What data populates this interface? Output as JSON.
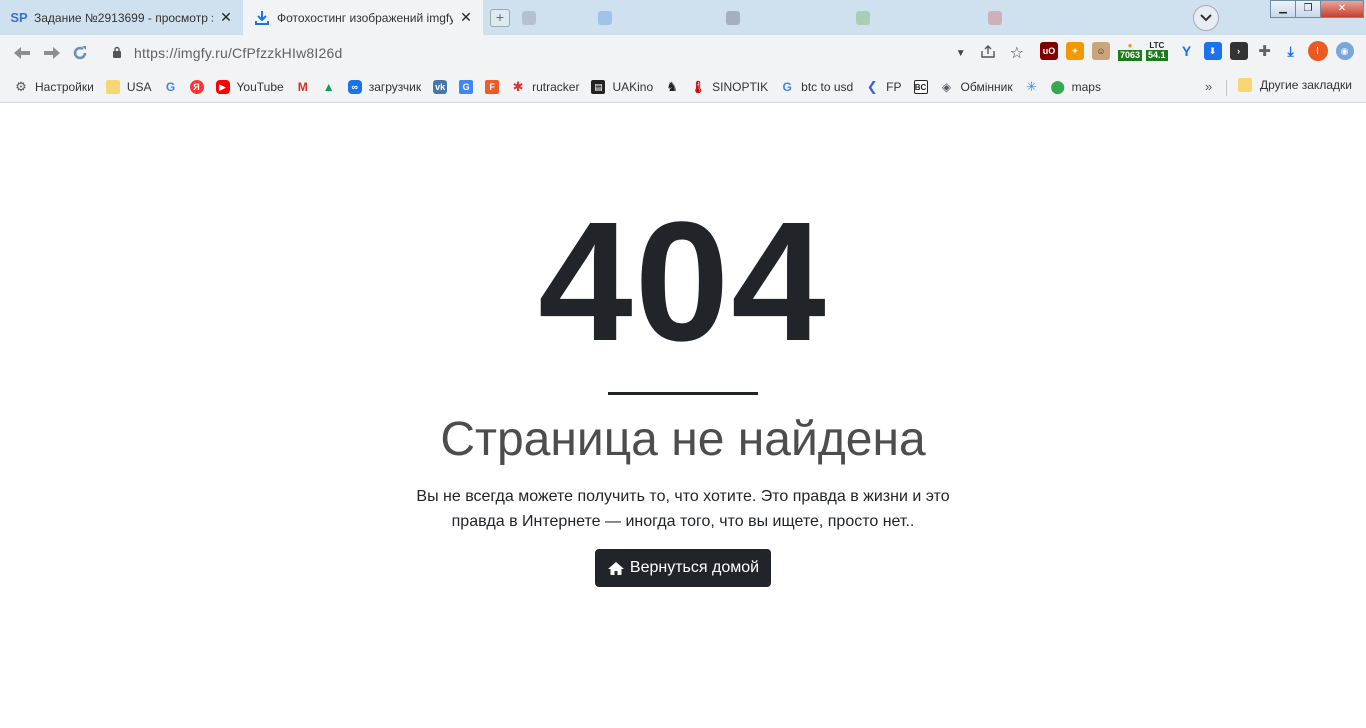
{
  "tabs": [
    {
      "favicon": "SP",
      "title": "Задание №2913699 - просмотр з",
      "active": false
    },
    {
      "favicon": "download-icon",
      "title": "Фотохостинг изображений imgfy",
      "active": true
    }
  ],
  "address_bar": {
    "url": "https://imgfy.ru/CfPfzzkHIw8I26d"
  },
  "extensions": {
    "counter_btc": "7063",
    "counter_ltc_label": "LTC",
    "counter_ltc_value": "54.1",
    "profile_initial": "I"
  },
  "bookmarks": [
    {
      "icon": "gear-icon",
      "label": "Настройки"
    },
    {
      "icon": "folder-icon",
      "label": "USA"
    },
    {
      "icon": "google-icon",
      "label": ""
    },
    {
      "icon": "yandex-icon",
      "label": ""
    },
    {
      "icon": "youtube-icon",
      "label": "YouTube"
    },
    {
      "icon": "gmail-icon",
      "label": ""
    },
    {
      "icon": "drive-icon",
      "label": ""
    },
    {
      "icon": "infinity-icon",
      "label": "загрузчик"
    },
    {
      "icon": "vk-icon",
      "label": ""
    },
    {
      "icon": "translate-icon",
      "label": ""
    },
    {
      "icon": "f-icon",
      "label": ""
    },
    {
      "icon": "rutracker-icon",
      "label": "rutracker"
    },
    {
      "icon": "uakino-icon",
      "label": "UAKino"
    },
    {
      "icon": "chess-icon",
      "label": ""
    },
    {
      "icon": "thermometer-icon",
      "label": "SINOPTIK"
    },
    {
      "icon": "google-icon",
      "label": "btc to usd"
    },
    {
      "icon": "fp-icon",
      "label": "FP"
    },
    {
      "icon": "bc-icon",
      "label": ""
    },
    {
      "icon": "exchange-icon",
      "label": "Обмінник"
    },
    {
      "icon": "star-icon",
      "label": ""
    },
    {
      "icon": "maps-icon",
      "label": "maps"
    }
  ],
  "bookmarks_more": "»",
  "other_bookmarks": "Другие закладки",
  "content": {
    "code": "404",
    "heading": "Страница не найдена",
    "desc_line1": "Вы не всегда можете получить то, что хотите. Это правда в жизни и это",
    "desc_line2": "правда в Интернете — иногда того, что вы ищете, просто нет..",
    "home_button": "Вернуться домой"
  },
  "colors": {
    "button_bg": "#212529",
    "heading": "#4d4d4d",
    "tabstrip": "#cfe0ef"
  }
}
